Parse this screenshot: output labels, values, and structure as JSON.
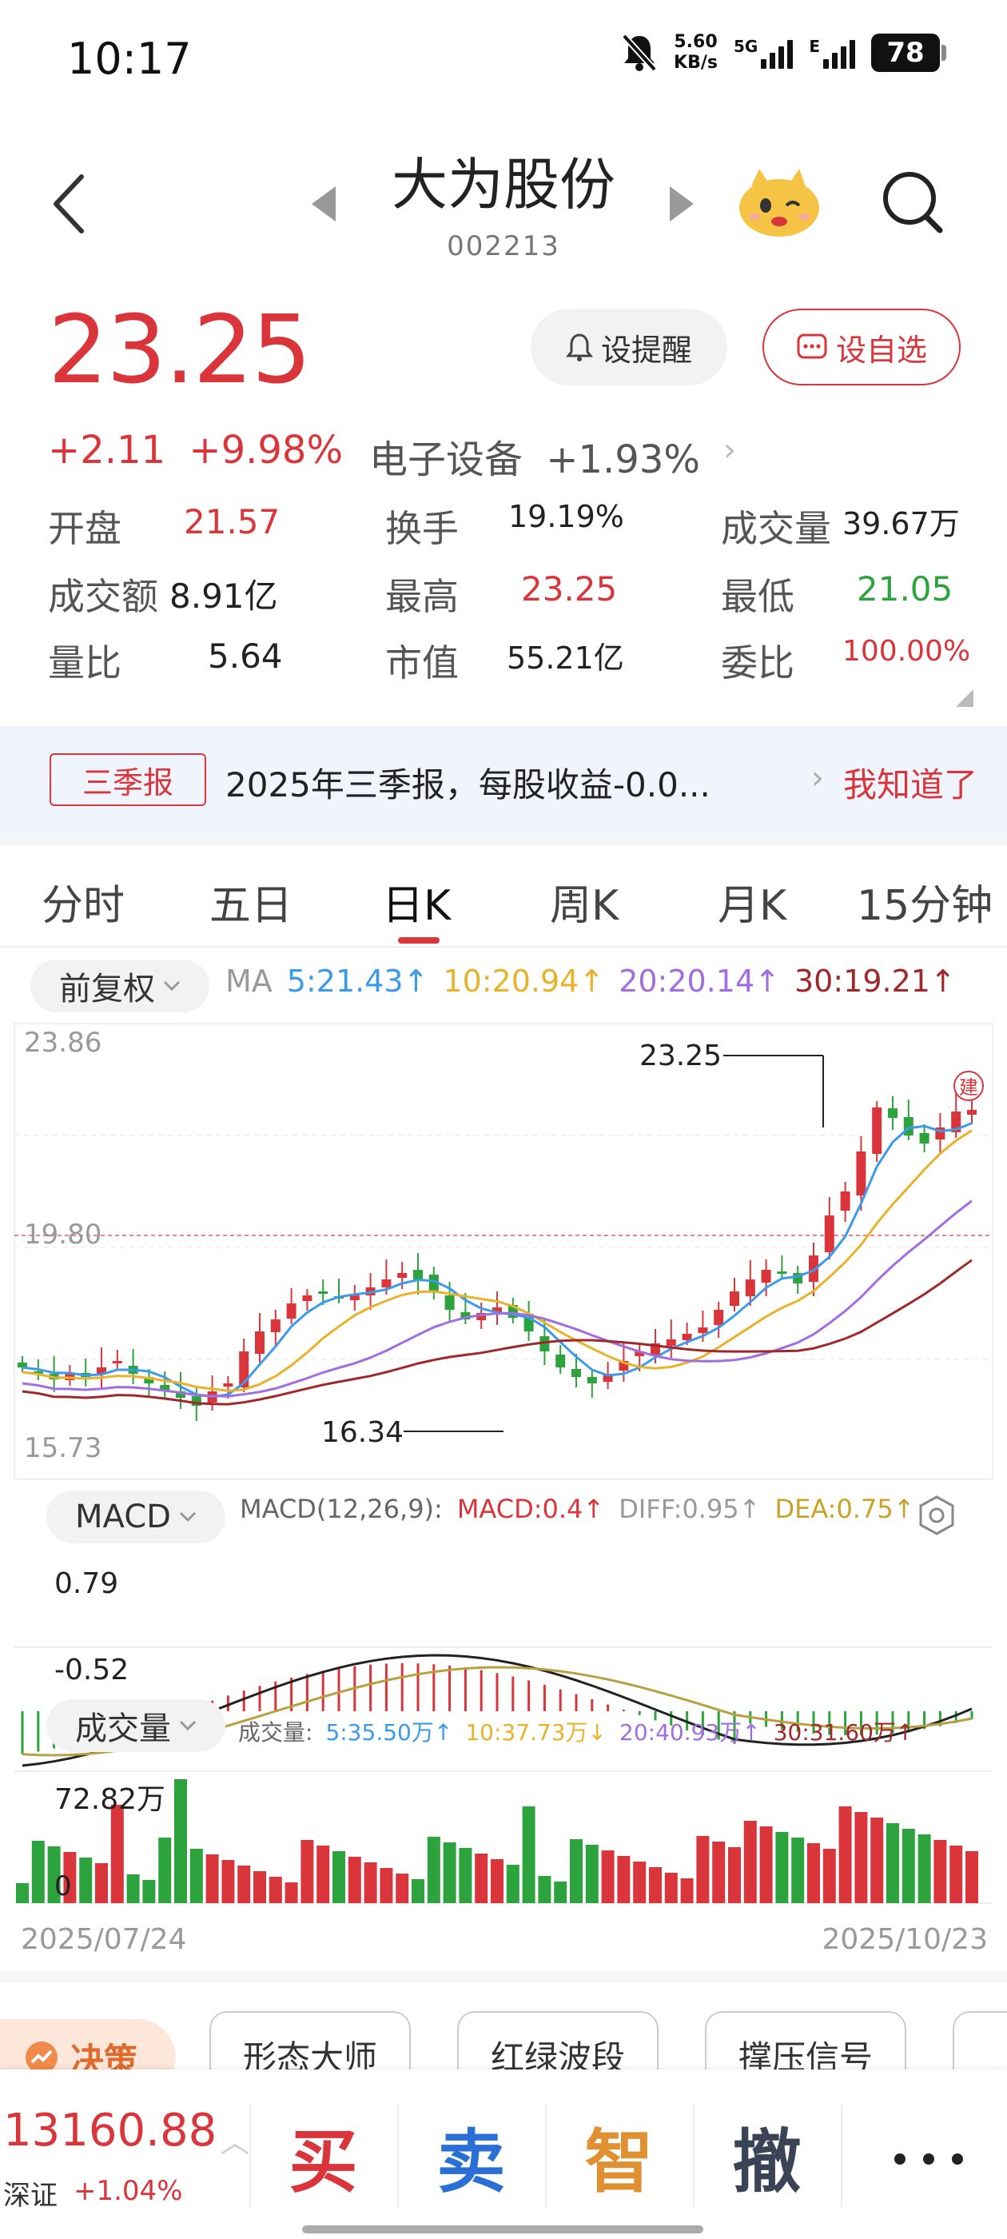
{
  "status_bar": {
    "time": "10:17",
    "net_speed_value": "5.60",
    "net_speed_unit": "KB/s",
    "signal_1": "5G",
    "signal_2": "E",
    "battery": "78"
  },
  "header": {
    "stock_name": "大为股份",
    "stock_code": "002213"
  },
  "quote": {
    "price": "23.25",
    "remind_label": "设提醒",
    "favorite_label": "设自选",
    "change_abs": "+2.11",
    "change_pct": "+9.98%",
    "sector_name": "电子设备",
    "sector_change": "+1.93%"
  },
  "stats": [
    {
      "label": "开盘",
      "value": "21.57",
      "color": "red"
    },
    {
      "label": "换手",
      "value": "19.19%",
      "color": "dark"
    },
    {
      "label": "成交量",
      "value": "39.67万",
      "color": "dark"
    },
    {
      "label": "成交额",
      "value": "8.91亿",
      "color": "dark"
    },
    {
      "label": "最高",
      "value": "23.25",
      "color": "red"
    },
    {
      "label": "最低",
      "value": "21.05",
      "color": "green"
    },
    {
      "label": "量比",
      "value": "5.64",
      "color": "dark"
    },
    {
      "label": "市值",
      "value": "55.21亿",
      "color": "dark"
    },
    {
      "label": "委比",
      "value": "100.00%",
      "color": "red"
    }
  ],
  "banner": {
    "tag": "三季报",
    "text": "2025年三季报，每股收益-0.0...",
    "action": "我知道了"
  },
  "tabs": [
    "分时",
    "五日",
    "日K",
    "周K",
    "月K",
    "15分钟"
  ],
  "active_tab": "日K",
  "kline": {
    "adjust_label": "前复权",
    "ma_label": "MA",
    "ma5": "5:21.43↑",
    "ma10": "10:20.94↑",
    "ma20": "20:20.14↑",
    "ma30": "30:19.21↑",
    "y_top": "23.86",
    "y_mid": "19.80",
    "y_bottom": "15.73",
    "high_label": "23.25",
    "low_label": "16.34",
    "build_badge": "建"
  },
  "macd": {
    "selector": "MACD",
    "params": "MACD(12,26,9):",
    "macd": "MACD:0.4↑",
    "diff": "DIFF:0.95↑",
    "dea": "DEA:0.75↑",
    "y_top": "0.79",
    "y_bottom": "-0.52"
  },
  "volume": {
    "selector": "成交量",
    "label": "成交量:",
    "v5": "5:35.50万↑",
    "v10": "10:37.73万↓",
    "v20": "20:40.93万↑",
    "v30": "30:31.60万↑",
    "y_top": "72.82万",
    "y_bottom": "0"
  },
  "dates": {
    "start": "2025/07/24",
    "end": "2025/10/23"
  },
  "tools": {
    "decision": "决策",
    "chips": [
      "形态大师",
      "红绿波段",
      "撑压信号"
    ]
  },
  "bottom": {
    "index_value": "13160.88",
    "index_name": "深证",
    "index_change": "+1.04%",
    "buy": "买",
    "sell": "卖",
    "smart": "智",
    "cancel": "撤"
  },
  "colors": {
    "up": "#d9353a",
    "down": "#2da33d",
    "ma5": "#3b9bea",
    "ma10": "#e8b22a",
    "ma20": "#a06ee0",
    "ma30": "#a0282a"
  }
}
